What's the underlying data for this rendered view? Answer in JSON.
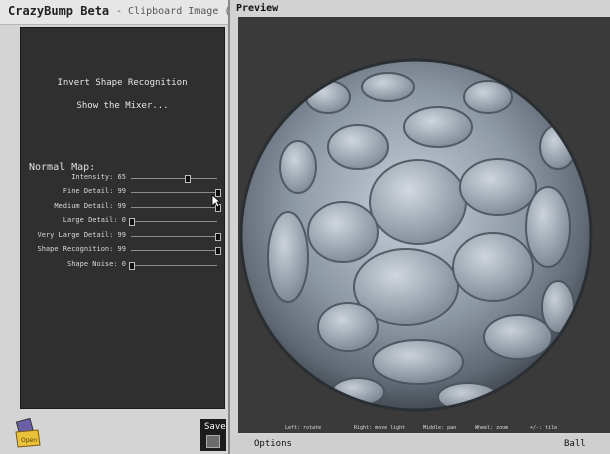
{
  "app": {
    "title": "CrazyBump Beta",
    "subtitle": "- Clipboard Image ("
  },
  "menu": {
    "invert": "Invert Shape Recognition",
    "mixer": "Show the Mixer..."
  },
  "normal_map": {
    "header": "Normal Map:",
    "sliders": [
      {
        "label": "Intensity: 65",
        "value": 65
      },
      {
        "label": "Fine Detail: 99",
        "value": 99
      },
      {
        "label": "Medium Detail: 99",
        "value": 99
      },
      {
        "label": "Large Detail: 0",
        "value": 0
      },
      {
        "label": "Very Large Detail: 99",
        "value": 99
      },
      {
        "label": "Shape Recognition: 99",
        "value": 99
      },
      {
        "label": "Shape Noise: 0",
        "value": 0
      }
    ]
  },
  "buttons": {
    "open": "Open",
    "save": "Save"
  },
  "preview": {
    "title": "Preview",
    "hints": [
      "Left: rotate",
      "Right: move light",
      "Middle: pan",
      "Wheel: zoom",
      "+/-: tile"
    ],
    "options": "Options",
    "mode": "Ball"
  },
  "colors": {
    "panel_dark": "#2f2f2f",
    "viewport_bg": "#3a3a3a",
    "ball_base": "#8a95a3"
  }
}
